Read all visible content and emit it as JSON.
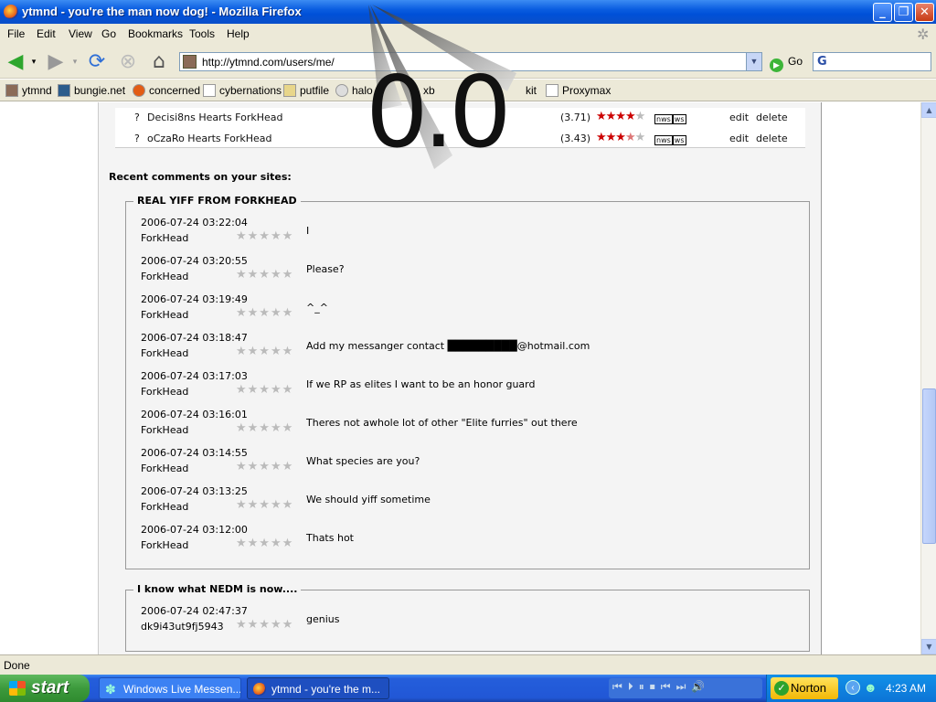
{
  "window": {
    "title": "ytmnd - you're the man now dog! - Mozilla Firefox"
  },
  "menu": [
    "File",
    "Edit",
    "View",
    "Go",
    "Bookmarks",
    "Tools",
    "Help"
  ],
  "nav": {
    "url": "http://ytmnd.com/users/me/",
    "go_label": "Go"
  },
  "bookmarks": [
    "ytmnd",
    "bungie.net",
    "concerned",
    "cybernations",
    "putfile",
    "halo",
    "xb",
    "kit",
    "Proxymax"
  ],
  "top_sites": [
    {
      "q": "?",
      "name": "Decisi8ns Hearts ForkHead",
      "score": "(3.71)",
      "stars": 4,
      "half": false,
      "edit": "edit",
      "delete": "delete",
      "nws": "nws",
      "ws": "ws"
    },
    {
      "q": "?",
      "name": "oCzaRo Hearts ForkHead",
      "score": "(3.43)",
      "stars": 3,
      "half": true,
      "edit": "edit",
      "delete": "delete",
      "nws": "nws",
      "ws": "ws"
    }
  ],
  "recent_heading": "Recent comments on your sites:",
  "sections": [
    {
      "title": "REAL YIFF FROM FORKHEAD",
      "comments": [
        {
          "date": "2006-07-24 03:22:04",
          "author": "ForkHead",
          "text": "I"
        },
        {
          "date": "2006-07-24 03:20:55",
          "author": "ForkHead",
          "text": "Please?"
        },
        {
          "date": "2006-07-24 03:19:49",
          "author": "ForkHead",
          "text": "^_^"
        },
        {
          "date": "2006-07-24 03:18:47",
          "author": "ForkHead",
          "text": "Add my messanger contact █████████@hotmail.com"
        },
        {
          "date": "2006-07-24 03:17:03",
          "author": "ForkHead",
          "text": "If we RP as elites I want to be an honor guard"
        },
        {
          "date": "2006-07-24 03:16:01",
          "author": "ForkHead",
          "text": "Theres not awhole lot of other \"Elite furries\" out there"
        },
        {
          "date": "2006-07-24 03:14:55",
          "author": "ForkHead",
          "text": "What species are you?"
        },
        {
          "date": "2006-07-24 03:13:25",
          "author": "ForkHead",
          "text": "We should yiff sometime"
        },
        {
          "date": "2006-07-24 03:12:00",
          "author": "ForkHead",
          "text": "Thats hot"
        }
      ]
    },
    {
      "title": "I know what NEDM is now....",
      "comments": [
        {
          "date": "2006-07-24 02:47:37",
          "author": "dk9i43ut9fj5943",
          "text": "genius"
        }
      ]
    }
  ],
  "rating_empty": "★★★★★",
  "overlay_text": "0.0",
  "status": "Done",
  "taskbar": {
    "start": "start",
    "tasks": [
      "Windows Live Messen...",
      "ytmnd - you're the m..."
    ],
    "tray_app": "Norton",
    "clock": "4:23 AM"
  }
}
